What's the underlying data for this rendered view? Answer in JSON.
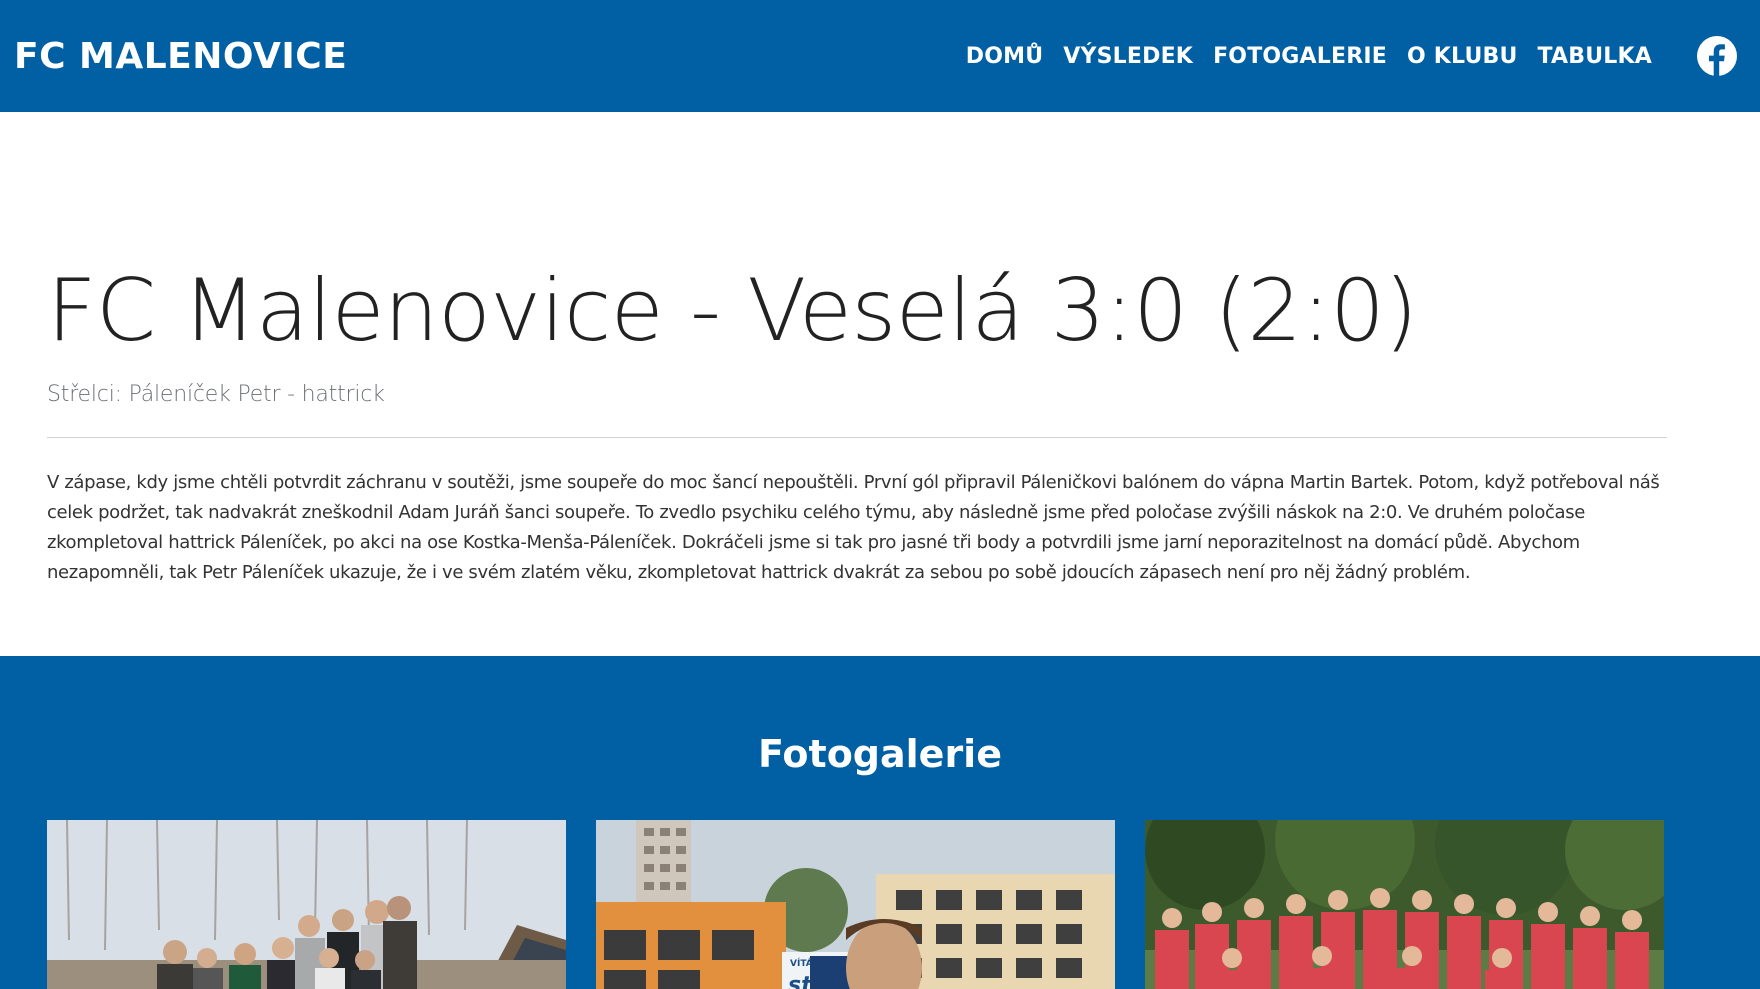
{
  "nav": {
    "brand": "FC MALENOVICE",
    "links": [
      "DOMŮ",
      "VÝSLEDEK",
      "FOTOGALERIE",
      "O KLUBU",
      "TABULKA"
    ],
    "social_icon": "facebook-icon"
  },
  "article": {
    "title": "FC Malenovice - Veselá 3:0 (2:0)",
    "scorers": "Střelci: Páleníček Petr - hattrick",
    "body": "V zápase, kdy jsme chtěli potvrdit záchranu v soutěži, jsme soupeře do moc šancí nepouštěli. První gól připravil Páleničkovi balónem do vápna Martin Bartek. Potom, když potřeboval náš celek podržet, tak nadvakrát zneškodnil Adam Juráň šanci soupeře. To zvedlo psychiku celého týmu, aby následně jsme před poločase zvýšili náskok na 2:0. Ve druhém poločase zkompletoval hattrick Páleníček, po akci na ose Kostka-Menša-Páleníček. Dokráčeli jsme si tak pro jasné tři body a potvrdili jsme jarní neporazitelnost na domácí půdě. Abychom nezapomněli, tak Petr Páleníček ukazuje, že i ve svém zlatém věku, zkompletovat hattrick dvakrát za sebou po sobě jdoucích zápasech není pro něj žádný problém."
  },
  "gallery": {
    "title": "Fotogalerie",
    "banner_text": "VÍTÁME V",
    "banner_text_2": "stři",
    "photos": [
      "group-photo",
      "player-portrait",
      "team-photo"
    ]
  },
  "colors": {
    "brand_blue": "#015fa4",
    "white": "#ffffff"
  }
}
